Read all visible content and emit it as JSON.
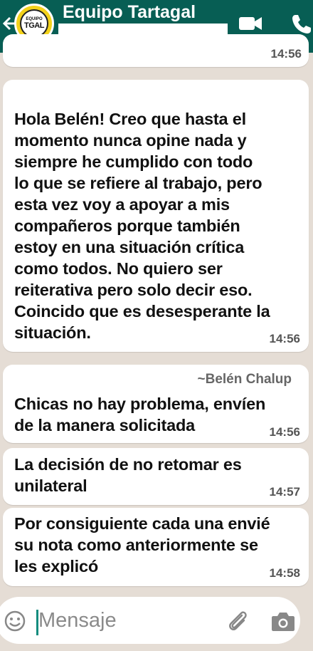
{
  "header": {
    "title": "Equipo Tartagal",
    "avatar_line1": "EQUIPO",
    "avatar_line2": "TGAL"
  },
  "messages": [
    {
      "text": "",
      "time": "14:56"
    },
    {
      "text": "Hola Belén! Creo que hasta el\nmomento nunca opine nada y\nsiempre he cumplido con todo\nlo que se refiere al trabajo, pero\nesta vez voy a apoyar a mis\ncompañeros porque también\nestoy en una situación crítica\ncomo todos. No quiero ser\nreiterativa pero solo decir eso.\nCoincido que es desesperante la\nsituación.",
      "time": "14:56"
    },
    {
      "sender": "~Belén Chalup",
      "text": "Chicas no hay problema, envíen\nde la manera solicitada",
      "time": "14:56"
    },
    {
      "text": "La decisión de no retomar es\nunilateral",
      "time": "14:57"
    },
    {
      "text": "Por consiguiente cada una envié\nsu nota como anteriormente se\nles explicó",
      "time": "14:58"
    }
  ],
  "input": {
    "placeholder": "Mensaje"
  },
  "icons": {
    "back": "arrow-back-icon",
    "video": "video-call-icon",
    "call": "phone-call-icon",
    "emoji": "emoji-icon",
    "attach": "paperclip-icon",
    "camera": "camera-icon"
  },
  "colors": {
    "header": "#075e54",
    "background": "#e5ddd5",
    "bubble": "#ffffff",
    "cursor": "#128c7e"
  }
}
